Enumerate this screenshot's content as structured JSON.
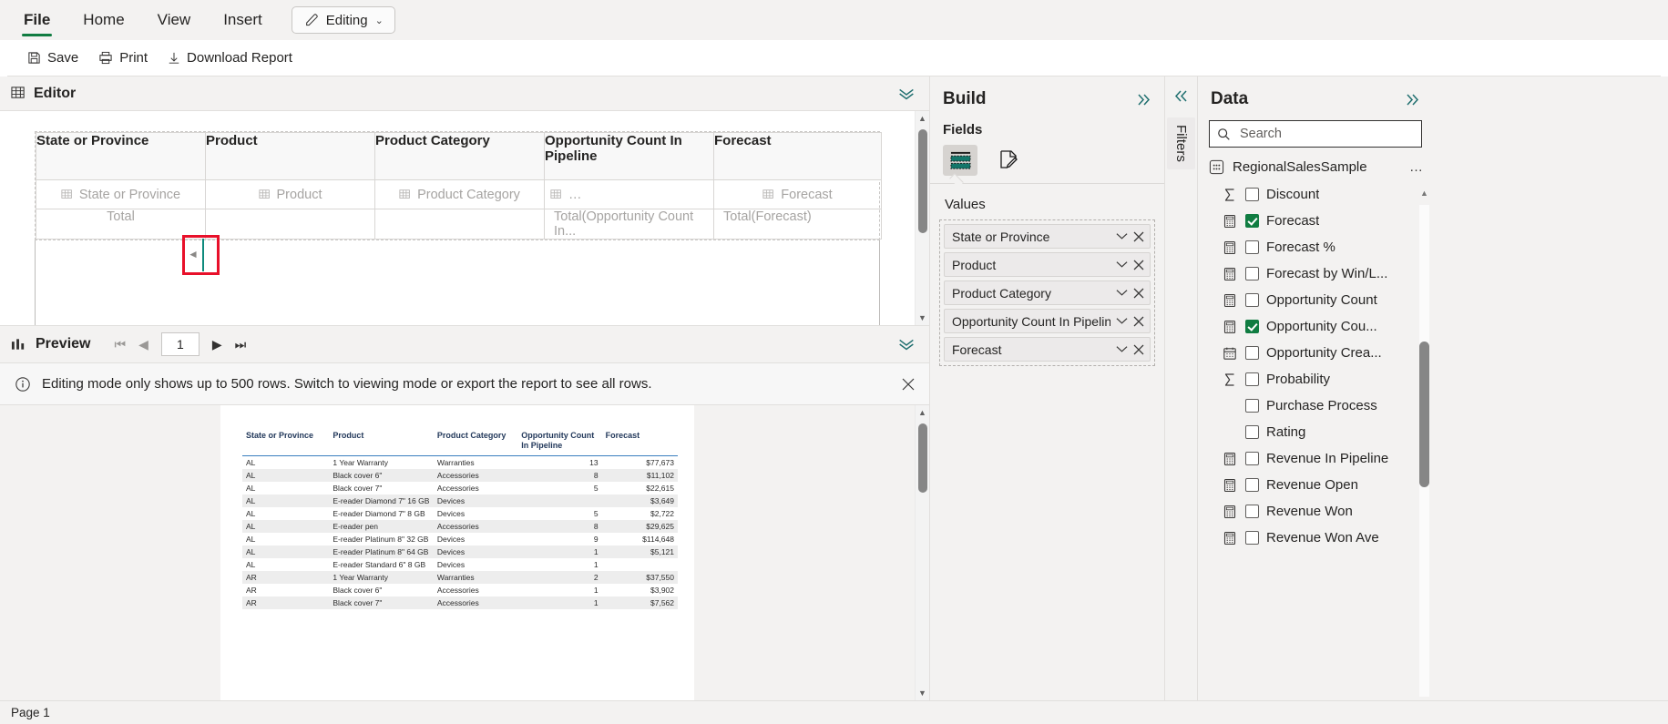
{
  "ribbon": {
    "tabs": [
      {
        "label": "File",
        "active": true
      },
      {
        "label": "Home",
        "active": false
      },
      {
        "label": "View",
        "active": false
      },
      {
        "label": "Insert",
        "active": false
      }
    ],
    "mode_chip": {
      "label": "Editing",
      "icon": "pencil-icon",
      "chevron": "chevron-down-icon"
    },
    "commands": [
      {
        "label": "Save",
        "icon": "save-icon"
      },
      {
        "label": "Print",
        "icon": "print-icon"
      },
      {
        "label": "Download Report",
        "icon": "download-icon"
      }
    ]
  },
  "editor": {
    "title": "Editor",
    "collapse_icon": "double-chevron-down-icon",
    "tablix": {
      "headers": [
        "State or Province",
        "Product",
        "Product Category",
        "Opportunity Count In Pipeline",
        "Forecast"
      ],
      "data_row": [
        "State or Province",
        "Product",
        "Product Category",
        "…",
        "Forecast"
      ],
      "total_row": [
        "Total",
        "",
        "",
        "Total(Opportunity Count In...",
        "Total(Forecast)"
      ]
    },
    "scroll": {
      "up": "▲",
      "down": "▼"
    }
  },
  "preview": {
    "title": "Preview",
    "collapse_icon": "double-chevron-down-icon",
    "nav": {
      "first": "⏮",
      "prev": "◀",
      "page_value": "1",
      "next": "▶",
      "last": "⏭"
    },
    "info": {
      "icon": "info-icon",
      "message": "Editing mode only shows up to 500 rows. Switch to viewing mode or export the report to see all rows.",
      "close_icon": "close-icon"
    }
  },
  "report_table": {
    "columns": [
      "State or Province",
      "Product",
      "Product Category",
      "Opportunity Count In Pipeline",
      "Forecast"
    ],
    "rows": [
      [
        "AL",
        "1 Year Warranty",
        "Warranties",
        "13",
        "$77,673"
      ],
      [
        "AL",
        "Black cover 6\"",
        "Accessories",
        "8",
        "$11,102"
      ],
      [
        "AL",
        "Black cover 7\"",
        "Accessories",
        "5",
        "$22,615"
      ],
      [
        "AL",
        "E-reader Diamond 7\" 16 GB",
        "Devices",
        "",
        "$3,649"
      ],
      [
        "AL",
        "E-reader Diamond 7\" 8 GB",
        "Devices",
        "5",
        "$2,722"
      ],
      [
        "AL",
        "E-reader pen",
        "Accessories",
        "8",
        "$29,625"
      ],
      [
        "AL",
        "E-reader Platinum 8\" 32 GB",
        "Devices",
        "9",
        "$114,648"
      ],
      [
        "AL",
        "E-reader Platinum 8\" 64 GB",
        "Devices",
        "1",
        "$5,121"
      ],
      [
        "AL",
        "E-reader Standard 6\" 8 GB",
        "Devices",
        "1",
        ""
      ],
      [
        "AR",
        "1 Year Warranty",
        "Warranties",
        "2",
        "$37,550"
      ],
      [
        "AR",
        "Black cover 6\"",
        "Accessories",
        "1",
        "$3,902"
      ],
      [
        "AR",
        "Black cover 7\"",
        "Accessories",
        "1",
        "$7,562"
      ]
    ]
  },
  "build": {
    "title": "Build",
    "expand_icon": "double-chevron-right-icon",
    "fields_label": "Fields",
    "tab_icons": [
      {
        "name": "tablix-data-icon",
        "selected": true
      },
      {
        "name": "format-page-icon",
        "selected": false
      }
    ],
    "values_label": "Values",
    "values": [
      {
        "label": "State or Province",
        "chevron": "chevron-down-icon",
        "remove": "close-icon"
      },
      {
        "label": "Product",
        "chevron": "chevron-down-icon",
        "remove": "close-icon"
      },
      {
        "label": "Product Category",
        "chevron": "chevron-down-icon",
        "remove": "close-icon"
      },
      {
        "label": "Opportunity Count In Pipeline",
        "chevron": "chevron-down-icon",
        "remove": "close-icon"
      },
      {
        "label": "Forecast",
        "chevron": "chevron-down-icon",
        "remove": "close-icon"
      }
    ]
  },
  "filters": {
    "collapse_icon": "double-chevron-left-icon",
    "label": "Filters"
  },
  "data_panel": {
    "title": "Data",
    "expand_icon": "double-chevron-right-icon",
    "search": {
      "placeholder": "Search",
      "value": "",
      "icon": "search-icon"
    },
    "dataset": {
      "name": "RegionalSalesSample",
      "icon": "dataset-icon",
      "more": "…"
    },
    "fields": [
      {
        "label": "Discount",
        "icon": "sigma-icon",
        "checked": false
      },
      {
        "label": "Forecast",
        "icon": "measure-icon",
        "checked": true
      },
      {
        "label": "Forecast %",
        "icon": "measure-icon",
        "checked": false
      },
      {
        "label": "Forecast by Win/L...",
        "icon": "measure-icon",
        "checked": false
      },
      {
        "label": "Opportunity Count",
        "icon": "measure-icon",
        "checked": false
      },
      {
        "label": "Opportunity Cou...",
        "icon": "measure-icon",
        "checked": true
      },
      {
        "label": "Opportunity Crea...",
        "icon": "calendar-icon",
        "checked": false
      },
      {
        "label": "Probability",
        "icon": "sigma-icon",
        "checked": false
      },
      {
        "label": "Purchase Process",
        "icon": "none",
        "checked": false
      },
      {
        "label": "Rating",
        "icon": "none",
        "checked": false
      },
      {
        "label": "Revenue In Pipeline",
        "icon": "measure-icon",
        "checked": false
      },
      {
        "label": "Revenue Open",
        "icon": "measure-icon",
        "checked": false
      },
      {
        "label": "Revenue Won",
        "icon": "measure-icon",
        "checked": false
      },
      {
        "label": "Revenue Won Ave",
        "icon": "measure-icon",
        "checked": false
      }
    ]
  },
  "statusbar": {
    "page_label": "Page 1"
  },
  "colors": {
    "accent_green": "#107C41",
    "teal": "#1f6f6f",
    "highlight_red": "#e8102a",
    "panel_bg": "#f3f2f1"
  }
}
